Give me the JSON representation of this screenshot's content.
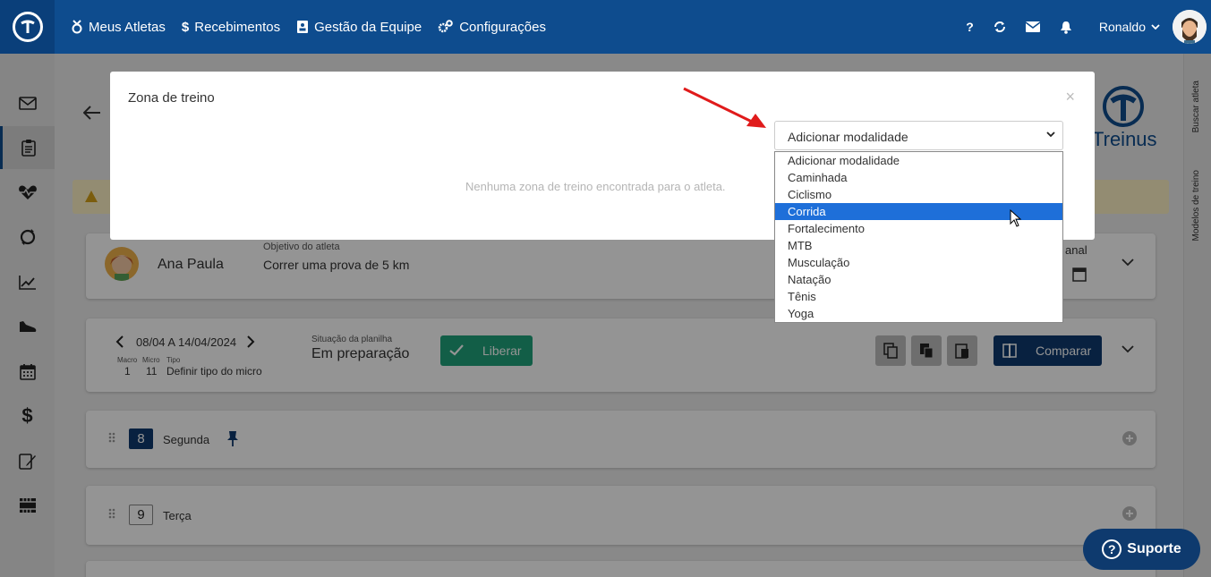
{
  "nav": {
    "items": [
      {
        "label": "Meus Atletas",
        "icon": "medal-icon"
      },
      {
        "label": "Recebimentos",
        "icon": "dollar-icon"
      },
      {
        "label": "Gestão da Equipe",
        "icon": "team-icon"
      },
      {
        "label": "Configurações",
        "icon": "gears-icon"
      }
    ],
    "help": "?",
    "user": "Ronaldo"
  },
  "rail": {
    "search_athlete": "Buscar atleta",
    "models": "Modelos de treino"
  },
  "background": {
    "athlete_name": "Ana Paula",
    "goal_label": "Objetivo do atleta",
    "goal_value": "Correr uma prova de 5 km",
    "week_range": "08/04 A 14/04/2024",
    "macro_label": "Macro",
    "micro_label": "Micro",
    "type_label": "Tipo",
    "macro_value": "1",
    "micro_value": "11",
    "type_value": "Definir tipo do micro",
    "status_label": "Situação da planilha",
    "status_value": "Em preparação",
    "release_button": "Liberar",
    "compare_button": "Comparar",
    "weekly_partial": "anal",
    "brand": "Treinus",
    "days": [
      {
        "num": "8",
        "name": "Segunda"
      },
      {
        "num": "9",
        "name": "Terça"
      }
    ]
  },
  "modal": {
    "title": "Zona de treino",
    "close": "×",
    "empty_message": "Nenhuma zona de treino encontrada para o atleta.",
    "select_value": "Adicionar modalidade",
    "options": [
      "Adicionar modalidade",
      "Caminhada",
      "Ciclismo",
      "Corrida",
      "Fortalecimento",
      "MTB",
      "Musculação",
      "Natação",
      "Tênis",
      "Yoga"
    ],
    "highlighted": "Corrida"
  },
  "support": {
    "label": "Suporte",
    "icon": "?"
  }
}
